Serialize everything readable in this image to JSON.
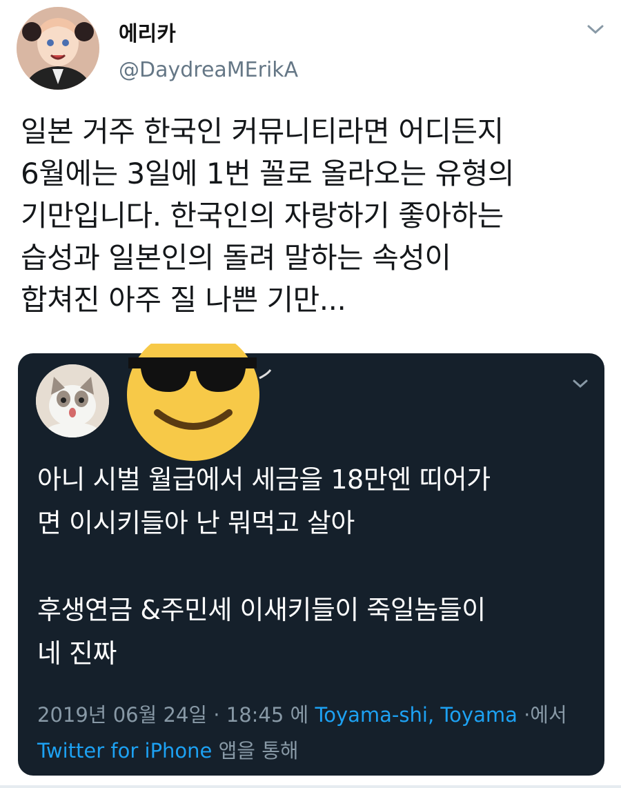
{
  "tweet": {
    "display_name": "에리카",
    "handle": "@DaydreaMErikA",
    "body": "일본 거주 한국인 커뮤니티라면 어디든지\n6월에는 3일에 1번 꼴로 올라오는 유형의\n기만입니다. 한국인의 자랑하기 좋아하는\n습성과 일본인의 돌려 말하는 속성이\n합쳐진 아주 질 나쁜 기만...",
    "menu_icon": "chevron-down-icon",
    "avatar_icon": "anime-avatar"
  },
  "quoted_tweet": {
    "avatar_icon": "cat-avatar",
    "name_cover": "sunglasses-emoji",
    "text": "아니 시벌 월급에서 세금을 18만엔 띠어가\n면 이시키들아 난 뭐먹고 살아\n\n후생연금 &주민세 이새키들이 죽일놈들이\n네 진짜",
    "date": "2019년 06월 24일",
    "separator": " · ",
    "time": "18:45",
    "at": " 에 ",
    "location": "Toyama-shi, Toyama",
    "location_suffix": " ·에서",
    "source": "Twitter for iPhone",
    "source_suffix": " 앱을 통해",
    "colors": {
      "card_bg": "#15202b",
      "link": "#1da1f2",
      "meta": "#8899a6"
    }
  }
}
